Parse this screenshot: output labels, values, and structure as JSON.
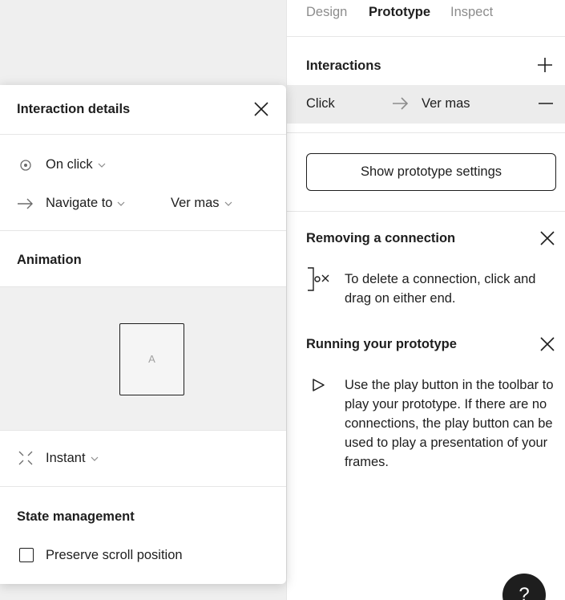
{
  "tabs": [
    {
      "label": "Design"
    },
    {
      "label": "Prototype"
    },
    {
      "label": "Inspect"
    }
  ],
  "interactions": {
    "title": "Interactions",
    "rows": [
      {
        "trigger": "Click",
        "destination": "Ver mas"
      }
    ]
  },
  "settings": {
    "button_label": "Show prototype settings"
  },
  "tips": {
    "removing": {
      "title": "Removing a connection",
      "body": "To delete a connection, click and drag on either end."
    },
    "running": {
      "title": "Running your prototype",
      "body": "Use the play button in the toolbar to play your prototype. If there are no connections, the play button can be used to play a presentation of your frames."
    }
  },
  "help": {
    "label": "?"
  },
  "popover": {
    "title": "Interaction details",
    "trigger": "On click",
    "action": "Navigate to",
    "destination": "Ver mas",
    "animation_title": "Animation",
    "preview_frame_label": "A",
    "transition": "Instant",
    "state_title": "State management",
    "preserve_scroll_label": "Preserve scroll position",
    "preserve_scroll_checked": false
  },
  "icons": {
    "plus": "plus-icon",
    "minus": "minus-icon",
    "close": "close-icon",
    "arrow": "arrow-right-icon",
    "target": "target-icon",
    "chevron": "chevron-down-icon",
    "disconnect": "disconnect-icon",
    "play": "play-icon",
    "instant": "instant-transition-icon"
  }
}
